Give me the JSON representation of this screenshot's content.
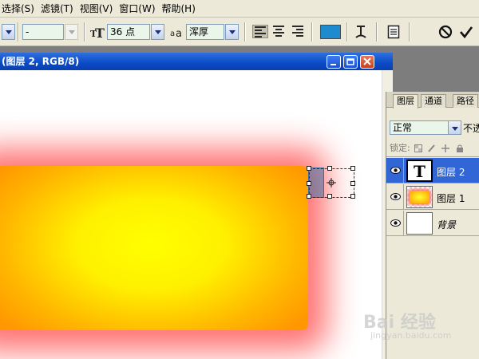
{
  "menu": [
    {
      "label": "选择(S)"
    },
    {
      "label": "滤镜(T)"
    },
    {
      "label": "视图(V)"
    },
    {
      "label": "窗口(W)"
    },
    {
      "label": "帮助(H)"
    }
  ],
  "options": {
    "font_style": "-",
    "font_size": "36 点",
    "antialias": "浑厚",
    "text_color": "#1d8bcd"
  },
  "document": {
    "title": "(图层 2, RGB/8)"
  },
  "layers_panel": {
    "tabs": [
      {
        "label": "图层"
      },
      {
        "label": "通道"
      },
      {
        "label": "路径"
      }
    ],
    "blend_mode": "正常",
    "opacity_label": "不透",
    "lock_label": "锁定:",
    "layers": [
      {
        "name": "图层 2",
        "thumb": "T",
        "selected": true
      },
      {
        "name": "图层 1",
        "selected": false
      },
      {
        "name": "背景",
        "selected": false
      }
    ]
  },
  "watermark": {
    "brand": "Bai 经验",
    "url": "jingyan.baidu.com"
  }
}
